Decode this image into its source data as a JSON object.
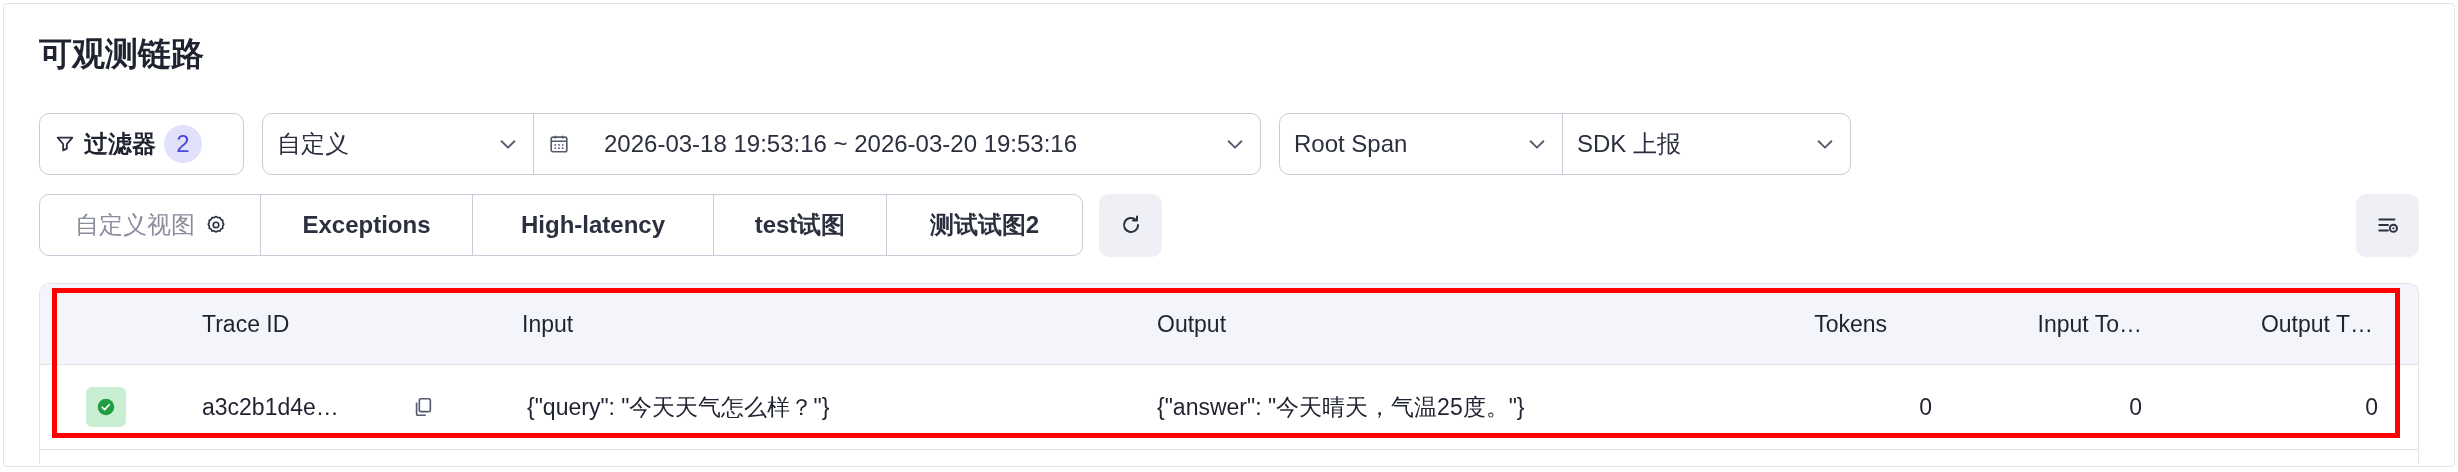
{
  "page": {
    "title": "可观测链路"
  },
  "filters": {
    "filter_button": {
      "label": "过滤器",
      "count": "2"
    },
    "time_preset": "自定义",
    "date_range": "2026-03-18 19:53:16 ~ 2026-03-20 19:53:16",
    "span_type": "Root Span",
    "source": "SDK 上报"
  },
  "views": [
    {
      "kind": "custom",
      "label": "自定义视图"
    },
    {
      "kind": "view",
      "label": "Exceptions"
    },
    {
      "kind": "view",
      "label": "High-latency"
    },
    {
      "kind": "view",
      "label": "test试图"
    },
    {
      "kind": "view",
      "label": "测试试图2"
    }
  ],
  "table": {
    "highlighted": true,
    "columns": [
      "Trace ID",
      "Input",
      "Output",
      "Tokens",
      "Input To…",
      "Output T…"
    ],
    "rows": [
      {
        "succeeded": true,
        "trace_id": "a3c2b1d4e…",
        "input": "{\"query\": \"今天天气怎么样？\"}",
        "output": "{\"answer\": \"今天晴天，气温25度。\"}",
        "tokens": "0",
        "input_tokens": "0",
        "output_tokens": "0"
      }
    ]
  }
}
